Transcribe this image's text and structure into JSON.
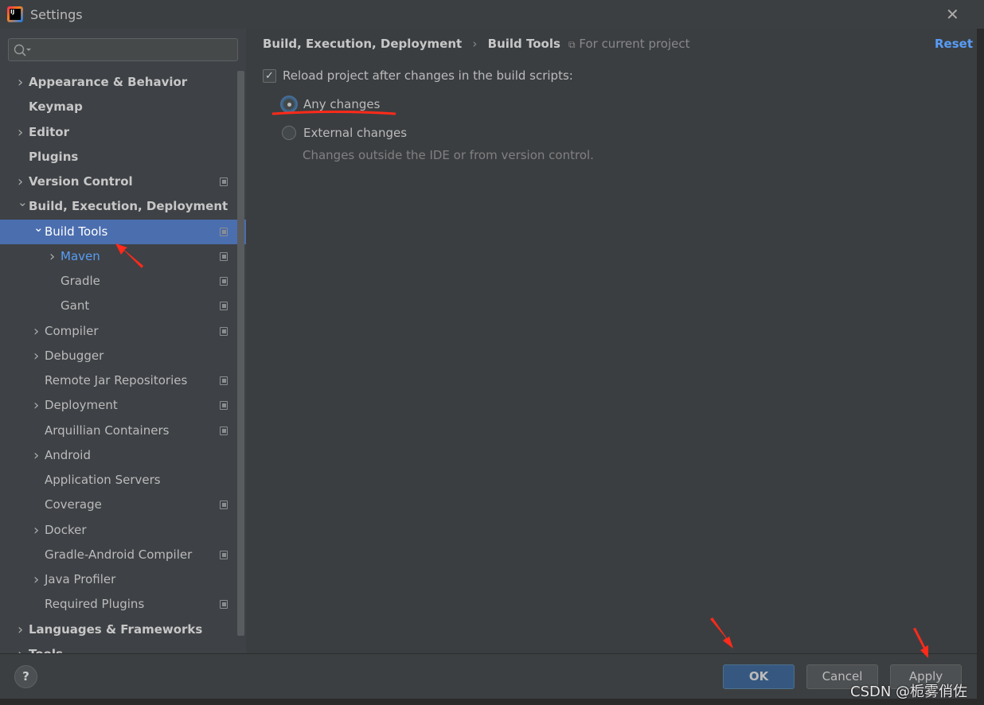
{
  "window": {
    "title": "Settings",
    "close_icon": "close-icon"
  },
  "search": {
    "placeholder": "",
    "value": ""
  },
  "tree": [
    {
      "label": "Appearance & Behavior",
      "level": 0,
      "bold": true,
      "expandable": true,
      "expanded": false,
      "project_scope": false
    },
    {
      "label": "Keymap",
      "level": 0,
      "bold": true,
      "expandable": false,
      "project_scope": false
    },
    {
      "label": "Editor",
      "level": 0,
      "bold": true,
      "expandable": true,
      "expanded": false,
      "project_scope": false
    },
    {
      "label": "Plugins",
      "level": 0,
      "bold": true,
      "expandable": false,
      "project_scope": false
    },
    {
      "label": "Version Control",
      "level": 0,
      "bold": true,
      "expandable": true,
      "expanded": false,
      "project_scope": true
    },
    {
      "label": "Build, Execution, Deployment",
      "level": 0,
      "bold": true,
      "expandable": true,
      "expanded": true,
      "project_scope": false
    },
    {
      "label": "Build Tools",
      "level": 1,
      "expandable": true,
      "expanded": true,
      "selected": true,
      "project_scope": true
    },
    {
      "label": "Maven",
      "level": 2,
      "expandable": true,
      "expanded": false,
      "highlight": "#589df6",
      "project_scope": true
    },
    {
      "label": "Gradle",
      "level": 2,
      "expandable": false,
      "project_scope": true
    },
    {
      "label": "Gant",
      "level": 2,
      "expandable": false,
      "project_scope": true
    },
    {
      "label": "Compiler",
      "level": 1,
      "expandable": true,
      "expanded": false,
      "project_scope": true
    },
    {
      "label": "Debugger",
      "level": 1,
      "expandable": true,
      "expanded": false,
      "project_scope": false
    },
    {
      "label": "Remote Jar Repositories",
      "level": 1,
      "expandable": false,
      "project_scope": true
    },
    {
      "label": "Deployment",
      "level": 1,
      "expandable": true,
      "expanded": false,
      "project_scope": true
    },
    {
      "label": "Arquillian Containers",
      "level": 1,
      "expandable": false,
      "project_scope": true
    },
    {
      "label": "Android",
      "level": 1,
      "expandable": true,
      "expanded": false,
      "project_scope": false
    },
    {
      "label": "Application Servers",
      "level": 1,
      "expandable": false,
      "project_scope": false
    },
    {
      "label": "Coverage",
      "level": 1,
      "expandable": false,
      "project_scope": true
    },
    {
      "label": "Docker",
      "level": 1,
      "expandable": true,
      "expanded": false,
      "project_scope": false
    },
    {
      "label": "Gradle-Android Compiler",
      "level": 1,
      "expandable": false,
      "project_scope": true
    },
    {
      "label": "Java Profiler",
      "level": 1,
      "expandable": true,
      "expanded": false,
      "project_scope": false
    },
    {
      "label": "Required Plugins",
      "level": 1,
      "expandable": false,
      "project_scope": true
    },
    {
      "label": "Languages & Frameworks",
      "level": 0,
      "bold": true,
      "expandable": true,
      "expanded": false,
      "project_scope": false
    },
    {
      "label": "Tools",
      "level": 0,
      "bold": true,
      "expandable": true,
      "expanded": false,
      "project_scope": false
    }
  ],
  "main": {
    "breadcrumb": [
      "Build, Execution, Deployment",
      "Build Tools"
    ],
    "breadcrumb_separator": "›",
    "scope_label": "For current project",
    "reset_label": "Reset",
    "reload_checkbox": {
      "label": "Reload project after changes in the build scripts:",
      "checked": true
    },
    "options": [
      {
        "label": "Any changes",
        "selected": true
      },
      {
        "label": "External changes",
        "selected": false
      }
    ],
    "external_hint": "Changes outside the IDE or from version control."
  },
  "footer": {
    "help": "?",
    "ok": "OK",
    "cancel": "Cancel",
    "apply": "Apply"
  },
  "watermark": "CSDN @栀雾俏佐",
  "colors": {
    "accent": "#589df6",
    "selection": "#4b6eaf",
    "ok_button": "#365880",
    "annotation": "#ff2a1a"
  }
}
